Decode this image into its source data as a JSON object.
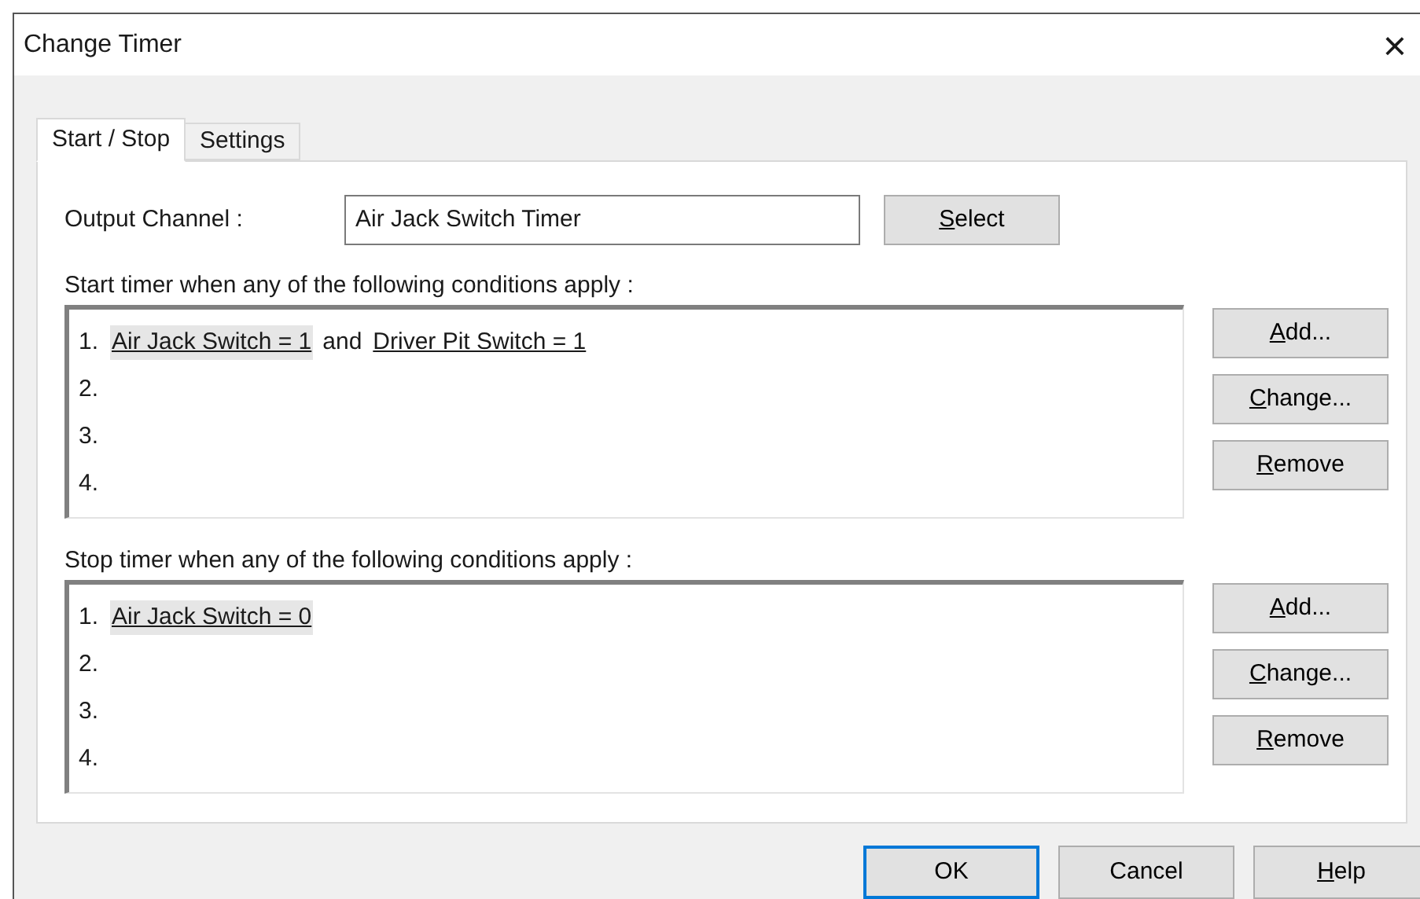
{
  "window": {
    "title": "Change Timer",
    "close": "×"
  },
  "tabs": [
    {
      "label": "Start / Stop",
      "selected": true
    },
    {
      "label": "Settings",
      "selected": false
    }
  ],
  "output_channel": {
    "label": "Output Channel :",
    "value": "Air Jack Switch Timer",
    "button": {
      "label": "Select",
      "underline_first": true
    }
  },
  "sections": [
    {
      "heading": "Start timer when any of the following conditions apply :",
      "rows": [
        {
          "number": "1.",
          "parts": [
            {
              "kind": "condition",
              "text": "Air Jack Switch = 1",
              "selected": true
            },
            {
              "kind": "word",
              "text": "and"
            },
            {
              "kind": "condition",
              "text": "Driver Pit Switch = 1",
              "selected": false
            }
          ]
        },
        {
          "number": "2.",
          "parts": []
        },
        {
          "number": "3.",
          "parts": []
        },
        {
          "number": "4.",
          "parts": []
        }
      ],
      "buttons": [
        {
          "label": "Add...",
          "underline_first": true
        },
        {
          "label": "Change...",
          "underline_first": true
        },
        {
          "label": "Remove",
          "underline_first": true
        }
      ]
    },
    {
      "heading": "Stop timer when any of the following conditions apply :",
      "rows": [
        {
          "number": "1.",
          "parts": [
            {
              "kind": "condition",
              "text": "Air Jack Switch = 0",
              "selected": true
            }
          ]
        },
        {
          "number": "2.",
          "parts": []
        },
        {
          "number": "3.",
          "parts": []
        },
        {
          "number": "4.",
          "parts": []
        }
      ],
      "buttons": [
        {
          "label": "Add...",
          "underline_first": true
        },
        {
          "label": "Change...",
          "underline_first": true
        },
        {
          "label": "Remove",
          "underline_first": true
        }
      ]
    }
  ],
  "footer_buttons": [
    {
      "label": "OK",
      "default": true,
      "underline_first": false
    },
    {
      "label": "Cancel",
      "default": false,
      "underline_first": false
    },
    {
      "label": "Help",
      "default": false,
      "underline_first": true
    }
  ]
}
